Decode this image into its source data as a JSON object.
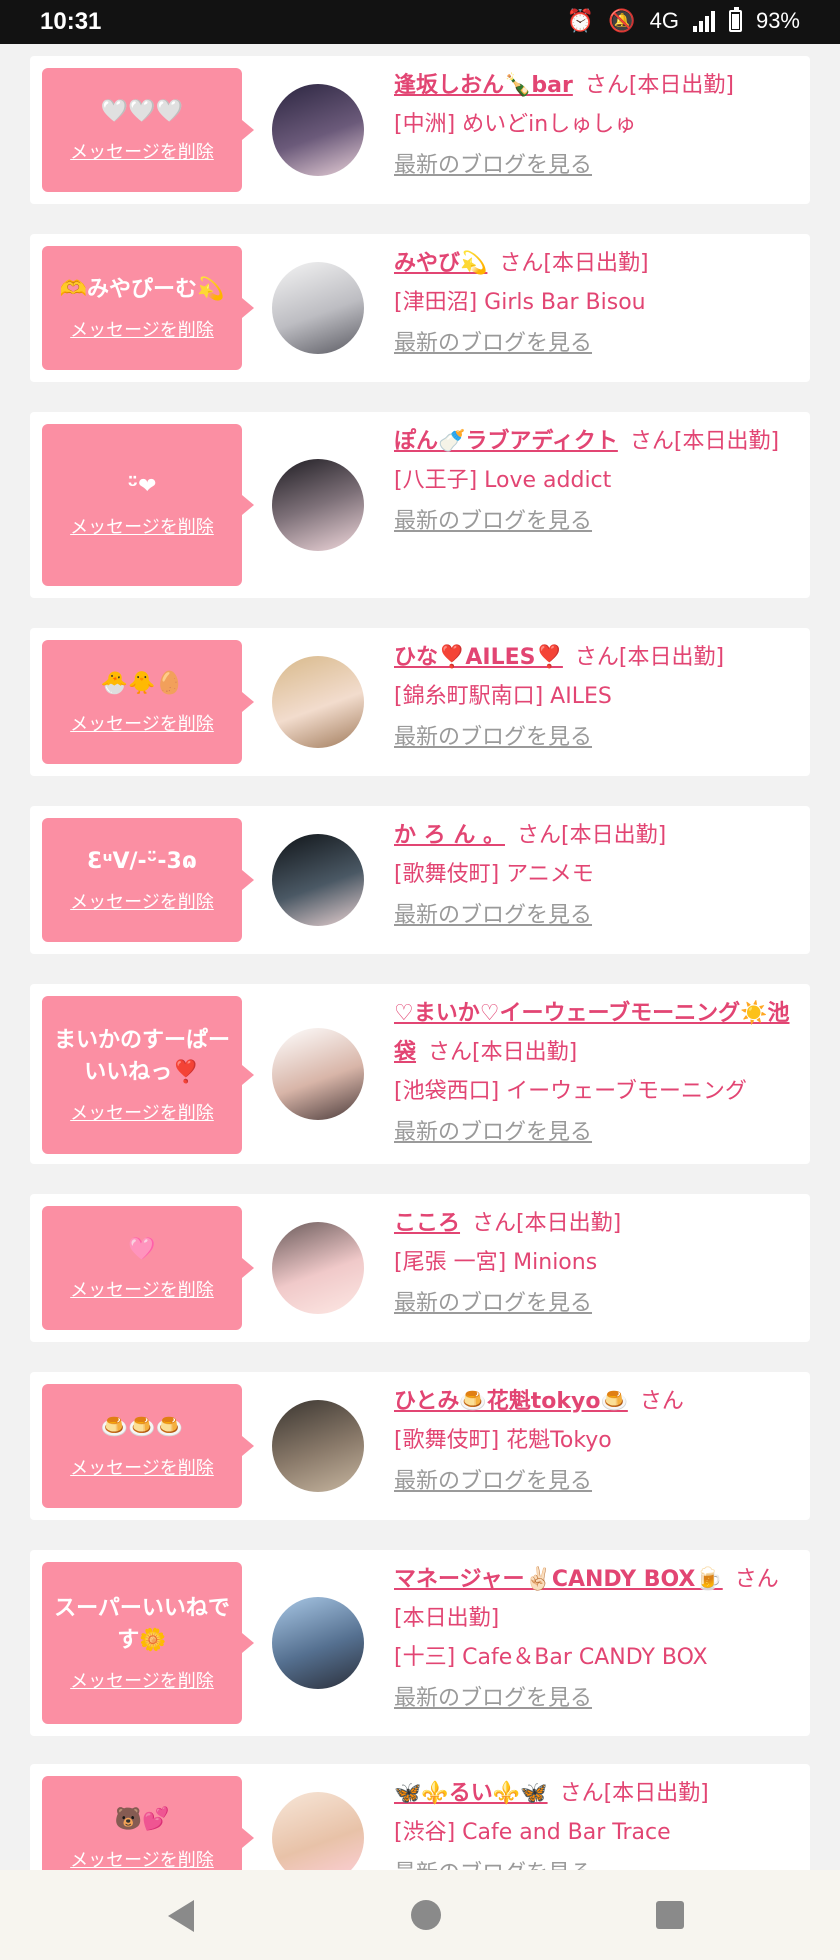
{
  "status_bar": {
    "time": "10:31",
    "network": "4G",
    "battery": "93%"
  },
  "common": {
    "delete_label": "メッセージを削除",
    "blog_label": "最新のブログを見る"
  },
  "cards": [
    {
      "message": "🤍🤍🤍",
      "name": "逢坂しおん🍾bar",
      "suffix": "さん[本日出勤]",
      "shop": "[中洲] めいどinしゅしゅ"
    },
    {
      "message": "🫶みやぴーむ💫",
      "name": "みやび💫",
      "suffix": "さん[本日出勤]",
      "shop": "[津田沼] Girls Bar Bisou"
    },
    {
      "message": "ᵕ̈❤",
      "name": "ぽん🍼ラブアディクト",
      "suffix": "さん[本日出勤]",
      "shop": "[八王子] Love addict"
    },
    {
      "message": "🐣🐥🥚",
      "name": "ひな❣️AILES❣️",
      "suffix": "さん[本日出勤]",
      "shop": "[錦糸町駅南口] AILES"
    },
    {
      "message": "ƐᵘV/-ᵕ̈-3ɷ",
      "name": "か ろ ん 。",
      "suffix": "さん[本日出勤]",
      "shop": "[歌舞伎町] アニメモ"
    },
    {
      "message": "まいかのすーぱーいいねっ❣️",
      "name": "♡まいか♡イーウェーブモーニング☀️池袋",
      "suffix": "さん[本日出勤]",
      "shop": "[池袋西口] イーウェーブモーニング"
    },
    {
      "message": "🩷",
      "name": "こころ",
      "suffix": "さん[本日出勤]",
      "shop": "[尾張 一宮] Minions"
    },
    {
      "message": "🍮🍮🍮",
      "name": "ひとみ🍮花魁tokyo🍮",
      "suffix": "さん",
      "shop": "[歌舞伎町] 花魁Tokyo"
    },
    {
      "message": "スーパーいいねです🌼",
      "name": "マネージャー✌🏻CANDY BOX🍺",
      "suffix": "さん[本日出勤]",
      "shop": "[十三] Cafe＆Bar CANDY BOX"
    },
    {
      "message": "🐻💕",
      "name": "🦋⚜️るい⚜️🦋",
      "suffix": "さん[本日出勤]",
      "shop": "[渋谷] Cafe and Bar Trace"
    }
  ]
}
